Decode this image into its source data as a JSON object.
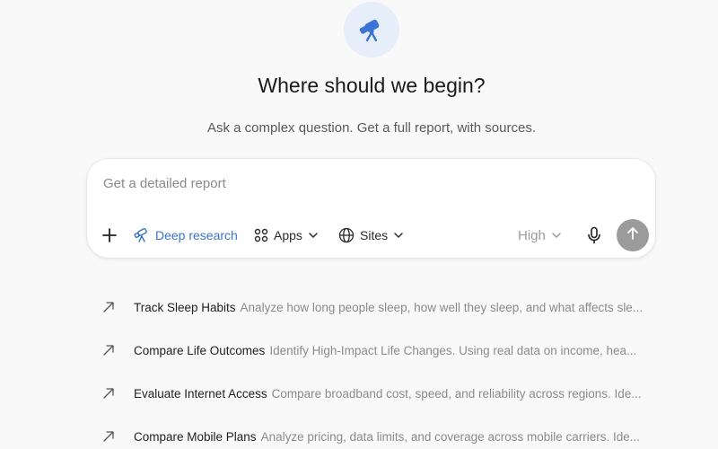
{
  "hero": {
    "icon": "telescope-icon",
    "title": "Where should we begin?",
    "subtitle": "Ask a complex question. Get a full report, with sources."
  },
  "composer": {
    "placeholder": "Get a detailed report",
    "value": "",
    "add_icon": "plus-icon",
    "deep_research_label": "Deep research",
    "apps_label": "Apps",
    "sites_label": "Sites",
    "level_label": "High",
    "mic_icon": "microphone-icon",
    "send_icon": "arrow-up-icon"
  },
  "colors": {
    "background": "#f9f9f9",
    "accent": "#3a73c4",
    "hero_icon_bg": "#e6eef9",
    "send_button": "#9b9b9b"
  },
  "suggestions": [
    {
      "icon": "arrow-up-right-icon",
      "title": "Track Sleep Habits",
      "description": "Analyze how long people sleep, how well they sleep, and what affects sle..."
    },
    {
      "icon": "arrow-up-right-icon",
      "title": "Compare Life Outcomes",
      "description": "Identify High-Impact Life Changes. Using real data on income, hea..."
    },
    {
      "icon": "arrow-up-right-icon",
      "title": "Evaluate Internet Access",
      "description": "Compare broadband cost, speed, and reliability across regions. Ide..."
    },
    {
      "icon": "arrow-up-right-icon",
      "title": "Compare Mobile Plans",
      "description": "Analyze pricing, data limits, and coverage across mobile carriers. Ide..."
    }
  ]
}
